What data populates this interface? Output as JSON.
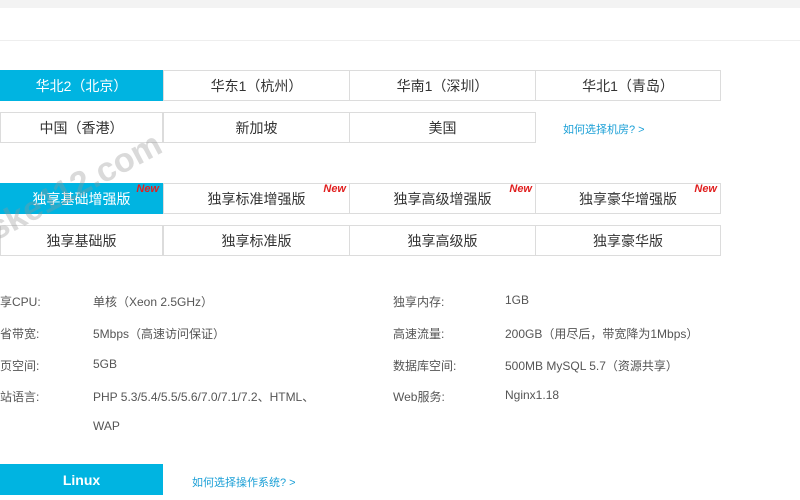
{
  "regions": [
    {
      "label": "华北2（北京）",
      "active": true
    },
    {
      "label": "华东1（杭州）",
      "active": false
    },
    {
      "label": "华南1（深圳）",
      "active": false
    },
    {
      "label": "华北1（青岛）",
      "active": false
    },
    {
      "label": "中国（香港）",
      "active": false
    },
    {
      "label": "新加坡",
      "active": false
    },
    {
      "label": "美国",
      "active": false
    }
  ],
  "region_help_link": "如何选择机房? >",
  "plans": [
    {
      "label": "独享基础增强版",
      "badge": "New",
      "active": true
    },
    {
      "label": "独享标准增强版",
      "badge": "New",
      "active": false
    },
    {
      "label": "独享高级增强版",
      "badge": "New",
      "active": false
    },
    {
      "label": "独享豪华增强版",
      "badge": "New",
      "active": false
    },
    {
      "label": "独享基础版",
      "active": false
    },
    {
      "label": "独享标准版",
      "active": false
    },
    {
      "label": "独享高级版",
      "active": false
    },
    {
      "label": "独享豪华版",
      "active": false
    }
  ],
  "specs": {
    "cpu_label": "享CPU:",
    "cpu_value": "单核（Xeon 2.5GHz）",
    "memory_label": "独享内存:",
    "memory_value": "1GB",
    "bandwidth_label": "省带宽:",
    "bandwidth_value": "5Mbps（高速访问保证）",
    "traffic_label": "高速流量:",
    "traffic_value": "200GB（用尽后，带宽降为1Mbps）",
    "space_label": "页空间:",
    "space_value": "5GB",
    "db_label": "数据库空间:",
    "db_value": "500MB MySQL 5.7（资源共享）",
    "lang_label": "站语言:",
    "lang_value_line1": "PHP 5.3/5.4/5.5/5.6/7.0/7.1/7.2、HTML、",
    "lang_value_line2": "WAP",
    "web_label": "Web服务:",
    "web_value": "Nginx1.18"
  },
  "os": {
    "selected": "Linux",
    "help_link": "如何选择操作系统? >"
  },
  "watermark": "ske112.com",
  "colors": {
    "accent": "#00b4e1",
    "badge": "#e02020",
    "link": "#1a9fd6"
  }
}
